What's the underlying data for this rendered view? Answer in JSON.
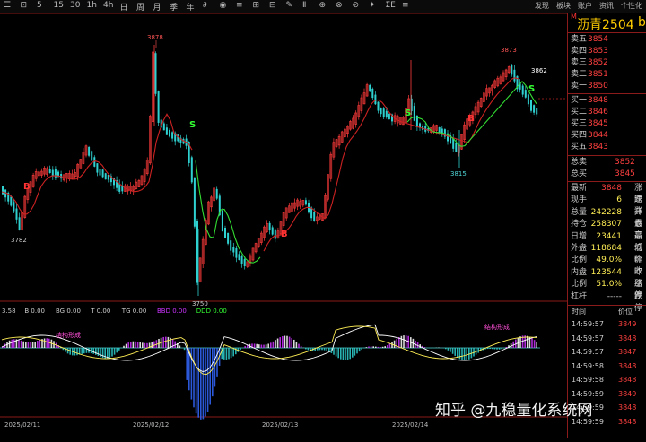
{
  "toolbar": {
    "items": [
      "☰",
      "⊡",
      "5",
      "15",
      "30",
      "1h",
      "4h",
      "日",
      "周",
      "月",
      "季",
      "年",
      "∂",
      "◉",
      "≡",
      "⊞",
      "⊟",
      "✎",
      "Ⅱ",
      "⊕",
      "⊗",
      "⊘",
      "✦",
      "ΣE",
      "≡"
    ],
    "right": [
      "发现",
      "板块",
      "账户",
      "资讯",
      "个性化"
    ]
  },
  "product": {
    "title": "沥青2504",
    "suffix": "b",
    "last_price": "3862"
  },
  "chart": {
    "high_label": "3878",
    "low_label": "3750",
    "peak2_label": "3873",
    "trough2_label": "3815",
    "left_low_label": "3782",
    "current_label": "3862",
    "signals": [
      {
        "text": "B",
        "color": "#ff3333"
      },
      {
        "text": "S",
        "color": "#33ff33"
      },
      {
        "text": "B",
        "color": "#ff3333"
      },
      {
        "text": "S",
        "color": "#33ff33"
      },
      {
        "text": "B",
        "color": "#ff3333"
      },
      {
        "text": "S",
        "color": "#33ff33"
      }
    ],
    "dates": [
      "2025/02/11",
      "2025/02/12",
      "2025/02/13",
      "2025/02/14"
    ],
    "colors": {
      "up": "#ff3b3b",
      "down": "#2fd0d0",
      "short_ma": "#33dd33",
      "long_ma": "#cc2222"
    }
  },
  "indicator_legend": [
    {
      "text": "3.58",
      "color": "#cccccc"
    },
    {
      "text": "B 0.00",
      "color": "#cccccc"
    },
    {
      "text": "BG 0.00",
      "color": "#cccccc"
    },
    {
      "text": "T 0.00",
      "color": "#cccccc"
    },
    {
      "text": "TG 0.00",
      "color": "#cccccc"
    },
    {
      "text": "BBD 0.00",
      "color": "#cc33ff"
    },
    {
      "text": "DDD 0.00",
      "color": "#33ff33"
    }
  ],
  "indicator_notes": [
    "结构形成",
    "结构形成"
  ],
  "order_book": {
    "asks": [
      {
        "label": "卖五",
        "price": "3854",
        "vol": ""
      },
      {
        "label": "卖四",
        "price": "3853",
        "vol": ""
      },
      {
        "label": "卖三",
        "price": "3852",
        "vol": ""
      },
      {
        "label": "卖二",
        "price": "3851",
        "vol": ""
      },
      {
        "label": "卖一",
        "price": "3850",
        "vol": ""
      }
    ],
    "bids": [
      {
        "label": "买一",
        "price": "3848"
      },
      {
        "label": "买二",
        "price": "3846"
      },
      {
        "label": "买三",
        "price": "3845"
      },
      {
        "label": "买四",
        "price": "3844"
      },
      {
        "label": "买五",
        "price": "3843"
      }
    ],
    "total_sell": {
      "label": "总卖",
      "price": "3852"
    },
    "total_buy": {
      "label": "总买",
      "price": "3845"
    }
  },
  "quote": [
    {
      "label": "最新",
      "value": "3848",
      "color": "#ff4040",
      "ext": "涨跌"
    },
    {
      "label": "现手",
      "value": "6",
      "color": "#ffee55",
      "ext": "速涨"
    },
    {
      "label": "总量",
      "value": "242228",
      "color": "#ffee55",
      "ext": "开仓"
    },
    {
      "label": "持仓",
      "value": "258307",
      "color": "#ffee55",
      "ext": "最高"
    },
    {
      "label": "日增",
      "value": "23441",
      "color": "#ffee55",
      "ext": "最低"
    },
    {
      "label": "外盘",
      "value": "118684",
      "color": "#ffee55",
      "ext": "均价"
    },
    {
      "label": "比例",
      "value": "49.0%",
      "color": "#ffee55",
      "ext": "昨收"
    },
    {
      "label": "内盘",
      "value": "123544",
      "color": "#ffee55",
      "ext": "昨结"
    },
    {
      "label": "比例",
      "value": "51.0%",
      "color": "#ffee55",
      "ext": "涨停"
    },
    {
      "label": "杠杆",
      "value": "-----",
      "color": "#cccccc",
      "ext": "跌停"
    }
  ],
  "ticks_header": {
    "time": "时间",
    "price": "价位"
  },
  "ticks": [
    {
      "time": "14:59:57",
      "price": "3849"
    },
    {
      "time": "14:59:57",
      "price": "3848"
    },
    {
      "time": "14:59:57",
      "price": "3847"
    },
    {
      "time": "14:59:58",
      "price": "3848"
    },
    {
      "time": "14:59:58",
      "price": "3848"
    },
    {
      "time": "14:59:59",
      "price": "3849"
    },
    {
      "time": "14:59:59",
      "price": "3848"
    },
    {
      "time": "14:59:59",
      "price": "3848"
    }
  ],
  "watermark": "知乎 @九稳量化系统网"
}
